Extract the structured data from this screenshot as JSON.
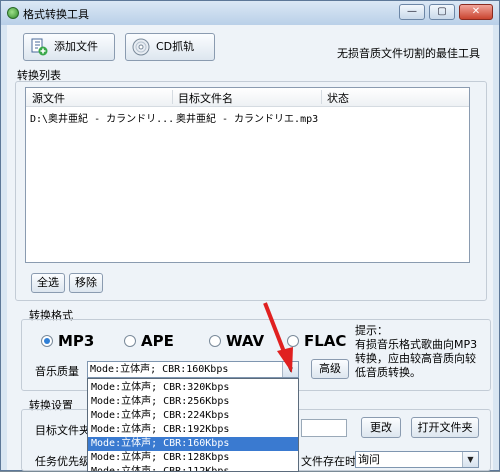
{
  "window": {
    "title": "格式转换工具",
    "minimize": "—",
    "maximize": "▢",
    "close": "✕"
  },
  "toolbar": {
    "add_file": "添加文件",
    "cd_rip": "CD抓轨",
    "slogan": "无损音质文件切割的最佳工具"
  },
  "file_list": {
    "label": "转换列表",
    "columns": [
      "源文件",
      "目标文件名",
      "状态"
    ],
    "rows": [
      {
        "source": "D:\\奥井亜紀 - カランドリ...",
        "target": "奥井亜紀 - カランドリエ.mp3",
        "status": ""
      }
    ]
  },
  "list_buttons": {
    "select_all": "全选",
    "remove": "移除"
  },
  "format": {
    "label": "转换格式",
    "options": [
      {
        "label": "MP3",
        "selected": true
      },
      {
        "label": "APE",
        "selected": false
      },
      {
        "label": "WAV",
        "selected": false
      },
      {
        "label": "FLAC",
        "selected": false
      }
    ],
    "hint": "提示：\n有损音乐格式歌曲向MP3转换，应由较高音质向较低音质转换。"
  },
  "quality": {
    "label": "音乐质量",
    "selected": "Mode:立体声; CBR:160Kbps",
    "advanced": "高级",
    "options": [
      "Mode:立体声; CBR:320Kbps",
      "Mode:立体声; CBR:256Kbps",
      "Mode:立体声; CBR:224Kbps",
      "Mode:立体声; CBR:192Kbps",
      "Mode:立体声; CBR:160Kbps",
      "Mode:立体声; CBR:128Kbps",
      "Mode:立体声; CBR:112Kbps"
    ],
    "highlighted_index": 4
  },
  "settings": {
    "label": "转换设置",
    "target_folder_label": "目标文件夹",
    "change": "更改",
    "open_folder": "打开文件夹",
    "priority_label": "任务优先级",
    "exists_label": "文件存在时",
    "exists_value": "询问"
  },
  "colors": {
    "accent": "#3a7ad0",
    "annotation_arrow": "#e02020"
  }
}
